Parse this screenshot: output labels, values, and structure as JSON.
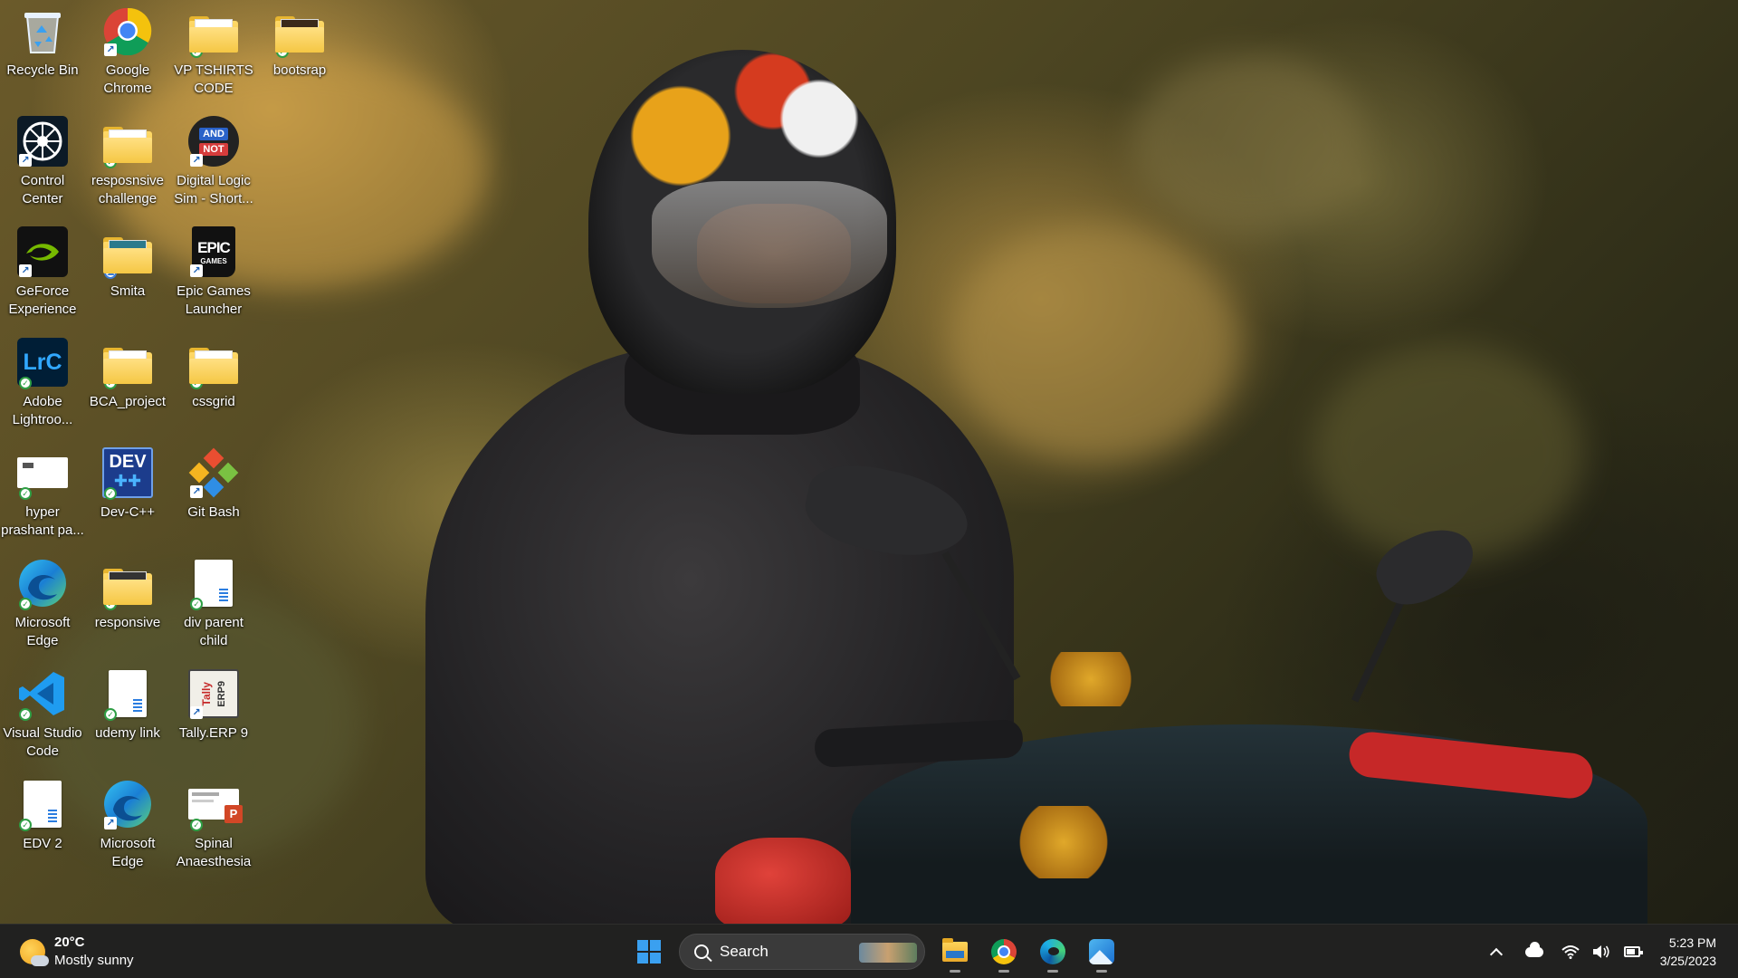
{
  "desktop": {
    "icons": [
      {
        "label": "Recycle Bin",
        "icon": "recycle-bin-icon"
      },
      {
        "label": "Google Chrome",
        "icon": "chrome-icon"
      },
      {
        "label": "VP TSHIRTS CODE",
        "icon": "folder-icon"
      },
      {
        "label": "bootsrap",
        "icon": "folder-icon"
      },
      {
        "label": "Control Center",
        "icon": "control-center-icon"
      },
      {
        "label": "resposnsive challenge",
        "icon": "folder-icon"
      },
      {
        "label": "Digital Logic Sim - Short...",
        "icon": "digital-logic-sim-icon",
        "badge_top": "AND",
        "badge_bottom": "NOT"
      },
      {
        "label": "GeForce Experience",
        "icon": "geforce-icon"
      },
      {
        "label": "Smita",
        "icon": "folder-icon"
      },
      {
        "label": "Epic Games Launcher",
        "icon": "epic-games-icon",
        "badge_top": "EPIC",
        "badge_bottom": "GAMES"
      },
      {
        "label": "Adobe Lightroo...",
        "icon": "lightroom-icon",
        "badge_top": "LrC"
      },
      {
        "label": "BCA_project",
        "icon": "folder-icon"
      },
      {
        "label": "cssgrid",
        "icon": "folder-icon"
      },
      {
        "label": "hyper prashant pa...",
        "icon": "document-icon"
      },
      {
        "label": "Dev-C++",
        "icon": "devcpp-icon",
        "badge_top": "DEV"
      },
      {
        "label": "Git Bash",
        "icon": "git-bash-icon"
      },
      {
        "label": "Microsoft Edge",
        "icon": "edge-icon"
      },
      {
        "label": "responsive",
        "icon": "folder-icon"
      },
      {
        "label": "div parent child",
        "icon": "document-icon"
      },
      {
        "label": "Visual Studio Code",
        "icon": "vscode-icon"
      },
      {
        "label": "udemy link",
        "icon": "document-icon"
      },
      {
        "label": "Tally.ERP 9",
        "icon": "tally-icon",
        "badge_top": "Tally",
        "badge_bottom": "ERP9"
      },
      {
        "label": "EDV 2",
        "icon": "document-icon"
      },
      {
        "label": "Microsoft Edge",
        "icon": "edge-icon"
      },
      {
        "label": "Spinal Anaesthesia",
        "icon": "powerpoint-icon",
        "badge_top": "P"
      }
    ]
  },
  "taskbar": {
    "weather": {
      "temp": "20°C",
      "condition": "Mostly sunny",
      "icon": "partly-sunny-icon"
    },
    "search_label": "Search",
    "pinned": [
      {
        "name": "start-button",
        "icon": "windows-logo-icon"
      },
      {
        "name": "file-explorer",
        "icon": "folder-icon"
      },
      {
        "name": "google-chrome",
        "icon": "chrome-icon"
      },
      {
        "name": "microsoft-edge",
        "icon": "edge-icon"
      },
      {
        "name": "photos",
        "icon": "photos-icon"
      }
    ],
    "tray": {
      "icons": [
        "chevron-up-icon",
        "onedrive-cloud-icon",
        "wifi-icon",
        "volume-icon",
        "battery-icon"
      ],
      "time": "5:23 PM",
      "date": "3/25/2023"
    }
  },
  "colors": {
    "taskbar_bg": "#202020",
    "accent": "#3aa0f0",
    "folder": "#f3c33c"
  }
}
